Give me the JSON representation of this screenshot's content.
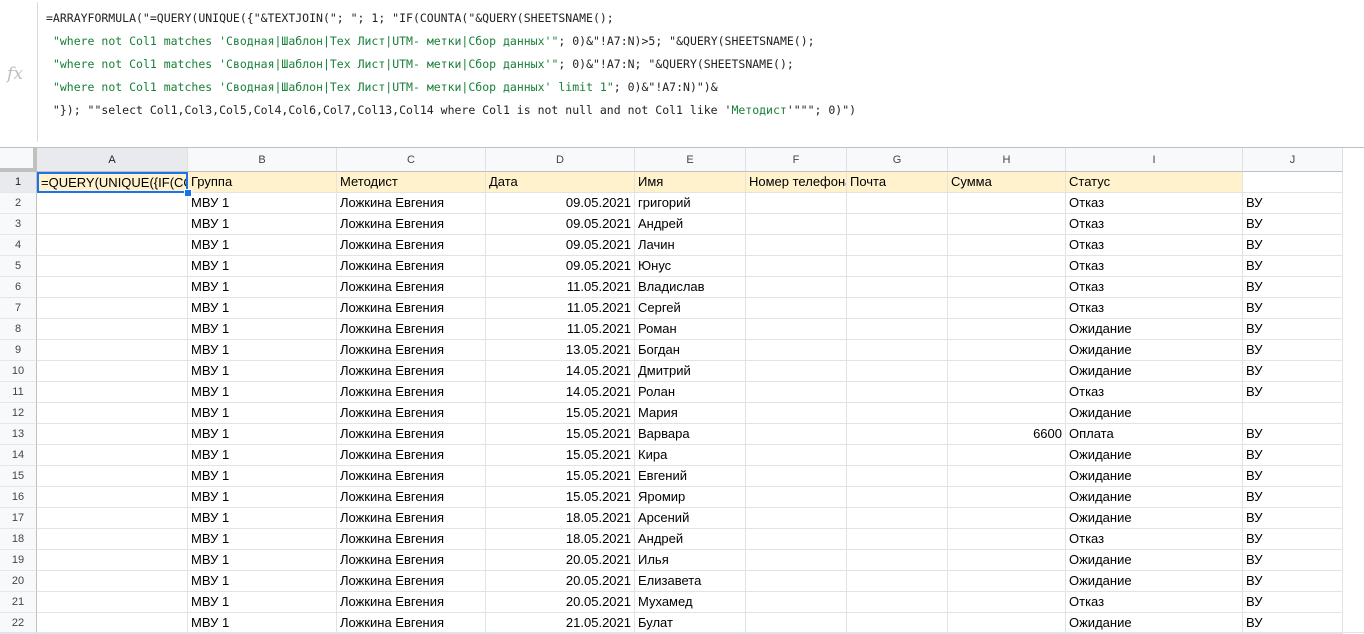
{
  "formula_bar": {
    "fx_icon": "fx",
    "lines": [
      [
        {
          "t": "=ARRAYFORMULA(\"=QUERY(UNIQUE({\"&TEXTJOIN(\"; \"; 1; \"IF(COUNTA(\"&QUERY(SHEETSNAME();",
          "s": false
        }
      ],
      [
        {
          "t": " ",
          "s": false
        },
        {
          "t": "\"where not Col1 matches '",
          "s": true
        },
        {
          "t": "Сводная|Шаблон|Тех Лист|UTM- метки|Сбор данных",
          "s": true
        },
        {
          "t": "'\"",
          "s": true
        },
        {
          "t": "; 0)&\"!A7:N)>5; \"&QUERY(SHEETSNAME();",
          "s": false
        }
      ],
      [
        {
          "t": " ",
          "s": false
        },
        {
          "t": "\"where not Col1 matches '",
          "s": true
        },
        {
          "t": "Сводная|Шаблон|Тех Лист|UTM- метки|Сбор данных",
          "s": true
        },
        {
          "t": "'\"",
          "s": true
        },
        {
          "t": "; 0)&\"!A7:N; \"&QUERY(SHEETSNAME();",
          "s": false
        }
      ],
      [
        {
          "t": " ",
          "s": false
        },
        {
          "t": "\"where not Col1 matches '",
          "s": true
        },
        {
          "t": "Сводная|Шаблон|Тех Лист|UTM- метки|Сбор данных",
          "s": true
        },
        {
          "t": "' limit 1\"",
          "s": true
        },
        {
          "t": "; 0)&\"!A7:N)\")&",
          "s": false
        }
      ],
      [
        {
          "t": " \"}); \"\"select Col1,Col3,Col5,Col4,Col6,Col7,Col13,Col14 where Col1 is not null and not Col1 like '",
          "s": false
        },
        {
          "t": "Методист",
          "s": true
        },
        {
          "t": "'\"\"\"; 0)\")",
          "s": false
        }
      ]
    ]
  },
  "columns": [
    "A",
    "B",
    "C",
    "D",
    "E",
    "F",
    "G",
    "H",
    "I",
    "J"
  ],
  "header_row": [
    "=QUERY(UNIQUE({IF(COUNTA(",
    "Группа",
    "Методист",
    "Дата",
    "Имя",
    "Номер телефона",
    "Почта",
    "Сумма",
    "Статус",
    ""
  ],
  "rows": [
    [
      "",
      "МВУ 1",
      "Ложкина Евгения",
      "09.05.2021",
      "григорий",
      "",
      "",
      "",
      "Отказ",
      "ВУ"
    ],
    [
      "",
      "МВУ 1",
      "Ложкина Евгения",
      "09.05.2021",
      "Андрей",
      "",
      "",
      "",
      "Отказ",
      "ВУ"
    ],
    [
      "",
      "МВУ 1",
      "Ложкина Евгения",
      "09.05.2021",
      "Лачин",
      "",
      "",
      "",
      "Отказ",
      "ВУ"
    ],
    [
      "",
      "МВУ 1",
      "Ложкина Евгения",
      "09.05.2021",
      "Юнус",
      "",
      "",
      "",
      "Отказ",
      "ВУ"
    ],
    [
      "",
      "МВУ 1",
      "Ложкина Евгения",
      "11.05.2021",
      "Владислав",
      "",
      "",
      "",
      "Отказ",
      "ВУ"
    ],
    [
      "",
      "МВУ 1",
      "Ложкина Евгения",
      "11.05.2021",
      "Сергей",
      "",
      "",
      "",
      "Отказ",
      "ВУ"
    ],
    [
      "",
      "МВУ 1",
      "Ложкина Евгения",
      "11.05.2021",
      "Роман",
      "",
      "",
      "",
      "Ожидание",
      "ВУ"
    ],
    [
      "",
      "МВУ 1",
      "Ложкина Евгения",
      "13.05.2021",
      "Богдан",
      "",
      "",
      "",
      "Ожидание",
      "ВУ"
    ],
    [
      "",
      "МВУ 1",
      "Ложкина Евгения",
      "14.05.2021",
      "Дмитрий",
      "",
      "",
      "",
      "Ожидание",
      "ВУ"
    ],
    [
      "",
      "МВУ 1",
      "Ложкина Евгения",
      "14.05.2021",
      "Ролан",
      "",
      "",
      "",
      "Отказ",
      "ВУ"
    ],
    [
      "",
      "МВУ 1",
      "Ложкина Евгения",
      "15.05.2021",
      "Мария",
      "",
      "",
      "",
      "Ожидание",
      ""
    ],
    [
      "",
      "МВУ 1",
      "Ложкина Евгения",
      "15.05.2021",
      "Варвара",
      "",
      "",
      "6600",
      "Оплата",
      "ВУ"
    ],
    [
      "",
      "МВУ 1",
      "Ложкина Евгения",
      "15.05.2021",
      "Кира",
      "",
      "",
      "",
      "Ожидание",
      "ВУ"
    ],
    [
      "",
      "МВУ 1",
      "Ложкина Евгения",
      "15.05.2021",
      "Евгений",
      "",
      "",
      "",
      "Ожидание",
      "ВУ"
    ],
    [
      "",
      "МВУ 1",
      "Ложкина Евгения",
      "15.05.2021",
      "Яромир",
      "",
      "",
      "",
      "Ожидание",
      "ВУ"
    ],
    [
      "",
      "МВУ 1",
      "Ложкина Евгения",
      "18.05.2021",
      "Арсений",
      "",
      "",
      "",
      "Ожидание",
      "ВУ"
    ],
    [
      "",
      "МВУ 1",
      "Ложкина Евгения",
      "18.05.2021",
      "Андрей",
      "",
      "",
      "",
      "Отказ",
      "ВУ"
    ],
    [
      "",
      "МВУ 1",
      "Ложкина Евгения",
      "20.05.2021",
      "Илья",
      "",
      "",
      "",
      "Ожидание",
      "ВУ"
    ],
    [
      "",
      "МВУ 1",
      "Ложкина Евгения",
      "20.05.2021",
      "Елизавета",
      "",
      "",
      "",
      "Ожидание",
      "ВУ"
    ],
    [
      "",
      "МВУ 1",
      "Ложкина Евгения",
      "20.05.2021",
      "Мухамед",
      "",
      "",
      "",
      "Отказ",
      "ВУ"
    ],
    [
      "",
      "МВУ 1",
      "Ложкина Евгения",
      "21.05.2021",
      "Булат",
      "",
      "",
      "",
      "Ожидание",
      "ВУ"
    ]
  ],
  "colors": {
    "header_fill": "#fff2cc",
    "selection": "#1a73e8",
    "string_literal": "#188038"
  },
  "active_cell": "A1"
}
